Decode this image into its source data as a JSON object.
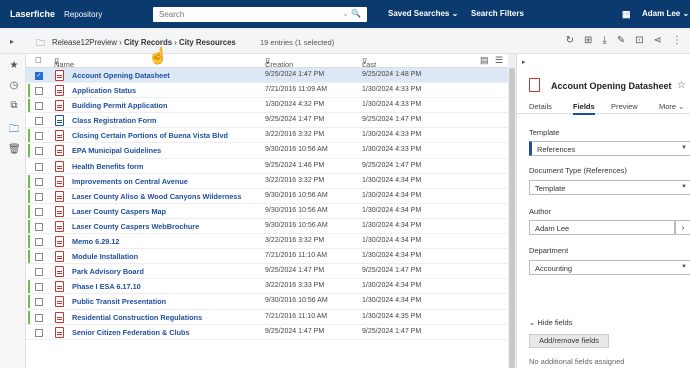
{
  "topbar": {
    "brand": "Laserfiche",
    "repository": "Repository",
    "search_placeholder": "Search",
    "saved_searches": "Saved Searches",
    "search_filters": "Search Filters",
    "user": "Adam Lee"
  },
  "toolbar": {
    "crumb_root": "Release12Preview",
    "crumb_mid": "City Records",
    "crumb_leaf": "City Resources",
    "entries": "19 entries (1 selected)"
  },
  "list": {
    "col_name": "Name",
    "col_created": "Creation date",
    "col_modified": "Last modified",
    "rows": [
      {
        "name": "Account Opening Datasheet",
        "created": "9/25/2024 1:47 PM",
        "modified": "9/25/2024 1:48 PM",
        "selected": true,
        "flag": false,
        "type": "pdf"
      },
      {
        "name": "Application Status",
        "created": "7/21/2016 11:09 AM",
        "modified": "1/30/2024 4:33 PM",
        "selected": false,
        "flag": true,
        "type": "pdf"
      },
      {
        "name": "Building Permit Application",
        "created": "1/30/2024 4:32 PM",
        "modified": "1/30/2024 4:33 PM",
        "selected": false,
        "flag": true,
        "type": "pdf"
      },
      {
        "name": "Class Registration Form",
        "created": "9/25/2024 1:47 PM",
        "modified": "9/25/2024 1:47 PM",
        "selected": false,
        "flag": false,
        "type": "form"
      },
      {
        "name": "Closing Certain Portions of Buena Vista Blvd",
        "created": "3/22/2016 3:32 PM",
        "modified": "1/30/2024 4:33 PM",
        "selected": false,
        "flag": true,
        "type": "pdf"
      },
      {
        "name": "EPA Municipal Guidelines",
        "created": "9/30/2016 10:56 AM",
        "modified": "1/30/2024 4:33 PM",
        "selected": false,
        "flag": true,
        "type": "pdf"
      },
      {
        "name": "Health Benefits form",
        "created": "9/25/2024 1:46 PM",
        "modified": "9/25/2024 1:47 PM",
        "selected": false,
        "flag": false,
        "type": "pdf"
      },
      {
        "name": "Improvements on Central Avenue",
        "created": "3/22/2016 3:32 PM",
        "modified": "1/30/2024 4:34 PM",
        "selected": false,
        "flag": true,
        "type": "pdf"
      },
      {
        "name": "Laser County Aliso & Wood Canyons Wilderness",
        "created": "9/30/2016 10:56 AM",
        "modified": "1/30/2024 4:34 PM",
        "selected": false,
        "flag": true,
        "type": "pdf"
      },
      {
        "name": "Laser County Caspers Map",
        "created": "9/30/2016 10:56 AM",
        "modified": "1/30/2024 4:34 PM",
        "selected": false,
        "flag": true,
        "type": "pdf"
      },
      {
        "name": "Laser County Caspers WebBrochure",
        "created": "9/30/2016 10:56 AM",
        "modified": "1/30/2024 4:34 PM",
        "selected": false,
        "flag": true,
        "type": "pdf"
      },
      {
        "name": "Memo 6.29.12",
        "created": "3/22/2016 3:32 PM",
        "modified": "1/30/2024 4:34 PM",
        "selected": false,
        "flag": true,
        "type": "pdf"
      },
      {
        "name": "Module Installation",
        "created": "7/21/2016 11:10 AM",
        "modified": "1/30/2024 4:34 PM",
        "selected": false,
        "flag": true,
        "type": "pdf"
      },
      {
        "name": "Park Advisory Board",
        "created": "9/25/2024 1:47 PM",
        "modified": "9/25/2024 1:47 PM",
        "selected": false,
        "flag": false,
        "type": "pdf"
      },
      {
        "name": "Phase I ESA 6.17.10",
        "created": "3/22/2016 3:33 PM",
        "modified": "1/30/2024 4:34 PM",
        "selected": false,
        "flag": true,
        "type": "pdf"
      },
      {
        "name": "Public Transit Presentation",
        "created": "9/30/2016 10:56 AM",
        "modified": "1/30/2024 4:34 PM",
        "selected": false,
        "flag": true,
        "type": "ppt"
      },
      {
        "name": "Residential Construction Regulations",
        "created": "7/21/2016 11:10 AM",
        "modified": "1/30/2024 4:35 PM",
        "selected": false,
        "flag": true,
        "type": "pdf"
      },
      {
        "name": "Senior Citizen Federation & Clubs",
        "created": "9/25/2024 1:47 PM",
        "modified": "9/25/2024 1:47 PM",
        "selected": false,
        "flag": false,
        "type": "pdf"
      }
    ]
  },
  "panel": {
    "title": "Account Opening Datasheet",
    "tabs": [
      "Details",
      "Fields",
      "Preview",
      "More"
    ],
    "template_label": "Template",
    "template_value": "References",
    "doctype_label": "Document Type (References)",
    "doctype_value": "Template",
    "author_label": "Author",
    "author_value": "Adam Lee",
    "department_label": "Department",
    "department_value": "Accounting",
    "hide_fields": "Hide fields",
    "add_remove": "Add/remove fields",
    "no_additional": "No additional fields assigned"
  },
  "colors": {
    "topbar": "#0b3a6e",
    "link": "#1f4e9c",
    "flag": "#6cc04a",
    "selected_row": "#dde8f6"
  }
}
